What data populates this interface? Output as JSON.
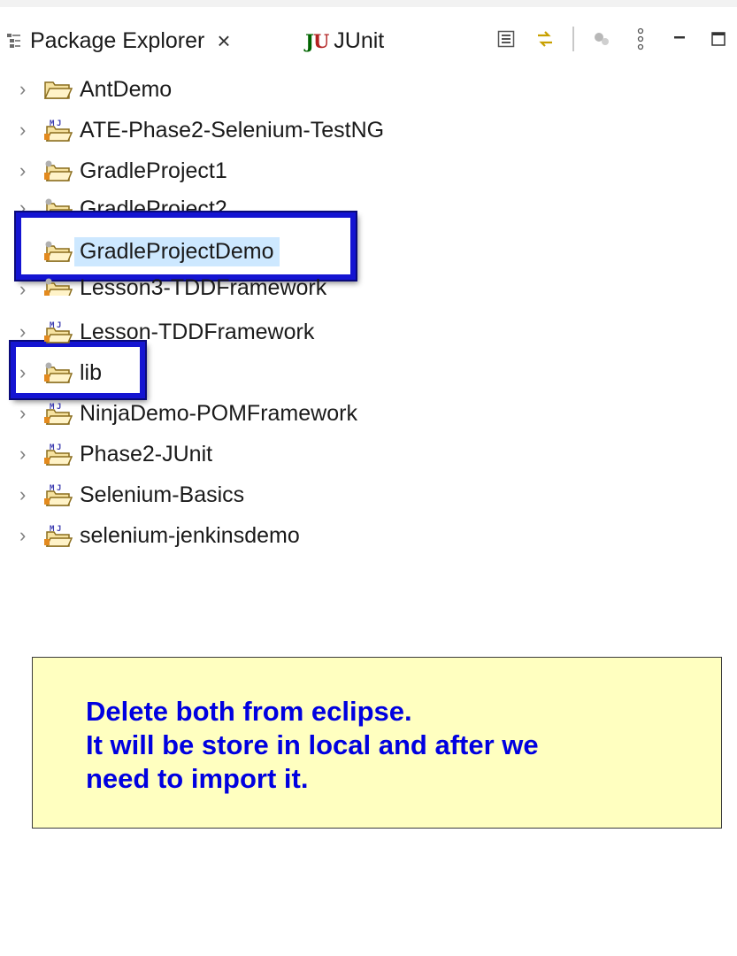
{
  "tabs": [
    {
      "label": "Package Explorer",
      "icon": "package-explorer-icon",
      "close": "×"
    },
    {
      "label": "JUnit",
      "icon": "junit-icon",
      "logo_j": "J",
      "logo_u": "U"
    }
  ],
  "toolbar": {
    "icons": [
      "collapse-all-icon",
      "link-with-editor-icon",
      "run-icon",
      "view-menu-icon",
      "minimize-icon",
      "maximize-icon"
    ]
  },
  "tree": {
    "items": [
      {
        "label": "AntDemo",
        "icon": "folder-project-icon"
      },
      {
        "label": "ATE-Phase2-Selenium-TestNG",
        "icon": "maven-project-icon"
      },
      {
        "label": "GradleProject1",
        "icon": "gradle-project-icon"
      },
      {
        "label": "GradleProject2",
        "icon": "gradle-project-icon"
      },
      {
        "label": "GradleProjectDemo",
        "icon": "gradle-project-icon",
        "selected": true
      },
      {
        "label": "Lesson3-TDDFramework",
        "icon": "gradle-project-icon"
      },
      {
        "label": "Lesson-TDDFramework",
        "icon": "maven-project-icon"
      },
      {
        "label": "lib",
        "icon": "gradle-project-icon"
      },
      {
        "label": "NinjaDemo-POMFramework",
        "icon": "maven-project-icon"
      },
      {
        "label": "Phase2-JUnit",
        "icon": "maven-project-icon"
      },
      {
        "label": "Selenium-Basics",
        "icon": "maven-project-icon"
      },
      {
        "label": "selenium-jenkinsdemo",
        "icon": "maven-project-icon"
      }
    ]
  },
  "note": {
    "lines": [
      "Delete both from eclipse.",
      "It will be store in local and after we",
      "need to import it."
    ]
  },
  "colors": {
    "highlight_border": "#1414d2",
    "note_bg": "#ffffc0",
    "note_text": "#0000e0",
    "selection_bg": "#cde8ff"
  }
}
